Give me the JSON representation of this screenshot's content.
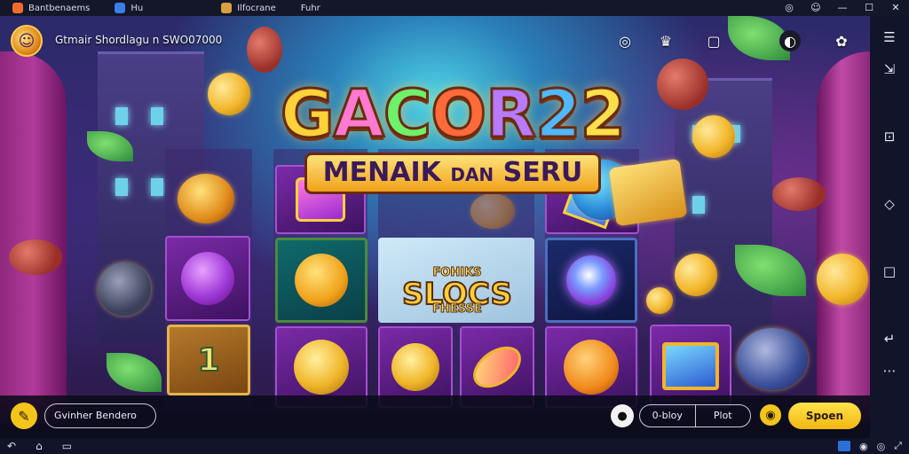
{
  "window": {
    "tabs": [
      {
        "label": "Bantbenaems",
        "icon": "app-icon",
        "color": "#f26a2a"
      },
      {
        "label": "Hu",
        "icon": "emulator-icon",
        "color": "#3a7ee8"
      },
      {
        "label": "Ilfocrane",
        "icon": "game-thumb-icon",
        "color": "#d8a040"
      },
      {
        "label": "Fuhr",
        "icon": "",
        "color": ""
      }
    ],
    "controls": [
      "◎",
      "☺",
      "—",
      "☐",
      "✕"
    ]
  },
  "game": {
    "logo": {
      "main": [
        "G",
        "A",
        "C",
        "O",
        "R",
        "2",
        "2"
      ],
      "sub_left": "MENAIK",
      "sub_mid": "DAN",
      "sub_right": "SERU"
    },
    "center_badge": {
      "top": "FOHIKS",
      "main": "SLOCS",
      "bottom": "FHESSE"
    },
    "reel_symbol_text": "1",
    "hud_top": {
      "title": "Gtmair Shordlagu n SWO07000",
      "icons": [
        "headset-icon",
        "trophy-icon",
        "notification-icon",
        "chat-icon",
        "settings-icon"
      ]
    },
    "hud_bottom": {
      "field_label": "Gvinher Bendero",
      "bet_left": "0-bloy",
      "bet_right": "Plot",
      "spin_label": "Spoen"
    }
  },
  "sidebar": {
    "icons": [
      "more-icon",
      "screenshot-icon",
      "install-icon",
      "erase-icon",
      "square-icon",
      "back-icon",
      "dots-icon"
    ]
  },
  "navbar": {
    "left_icons": [
      "back-icon",
      "home-icon",
      "recents-icon"
    ],
    "right_icons": [
      "keyboard-icon",
      "location-icon",
      "volume-icon",
      "fullscreen-icon"
    ]
  }
}
